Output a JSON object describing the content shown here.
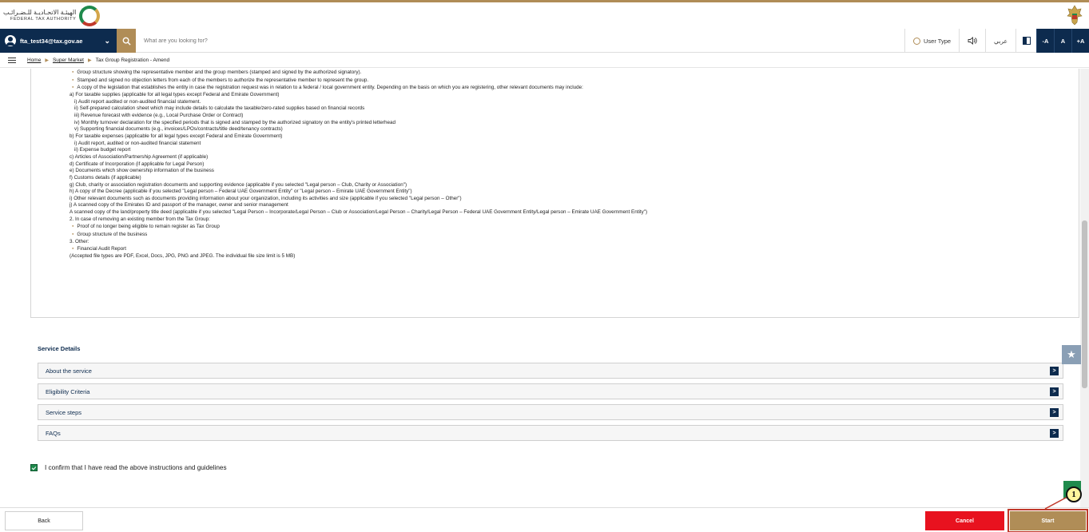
{
  "header": {
    "logo_ar": "الهيئـة الاتحـاديـة للـضـرائـب",
    "logo_en": "FEDERAL TAX AUTHORITY"
  },
  "toolbar": {
    "user_email": "fta_test34@tax.gov.ae",
    "search_placeholder": "What are you looking for?",
    "user_type_label": "User Type",
    "arabic_label": "عربي",
    "font_decrease": "-A",
    "font_normal": "A",
    "font_increase": "+A"
  },
  "breadcrumb": {
    "home": "Home",
    "section": "Super Market",
    "current": "Tax Group Registration - Amend"
  },
  "documents": {
    "lines": [
      {
        "t": "Group structure showing the representative member and the group members (stamped and signed by the authorized signatory).",
        "k": "b"
      },
      {
        "t": "Stamped and signed no objection letters from each of the members to authorize the representative member to represent the group.",
        "k": "b"
      },
      {
        "t": "A copy of the legislation that establishes the entity in case the registration request was in relation to a federal / local government entity. Depending on the basis on which you are registering, other relevant documents may include:",
        "k": "b"
      },
      {
        "t": "a) For taxable supplies (applicable for all legal types except Federal and Emirate Government)",
        "k": ""
      },
      {
        "t": "i) Audit report audited or non-audited financial statement.",
        "k": "i1"
      },
      {
        "t": "ii) Self-prepared calculation sheet which may include details to calculate the taxable/zero-rated supplies based on financial records",
        "k": "i1"
      },
      {
        "t": "iii) Revenue forecast with evidence (e.g., Local Purchase Order or Contract)",
        "k": "i1"
      },
      {
        "t": "iv) Monthly turnover declaration for the specified periods that is signed and stamped by the authorized signatory on the entity's printed letterhead",
        "k": "i1"
      },
      {
        "t": "v) Supporting financial documents (e.g., invoices/LPOs/contracts/title deed/tenancy contracts)",
        "k": "i1"
      },
      {
        "t": "b) For taxable expenses (applicable for all legal types except Federal and Emirate Government)",
        "k": ""
      },
      {
        "t": "i) Audit report, audited or non-audited financial statement",
        "k": "i1"
      },
      {
        "t": "ii) Expense budget report",
        "k": "i1"
      },
      {
        "t": "c) Articles of Association/Partnership Agreement (if applicable)",
        "k": ""
      },
      {
        "t": "d) Certificate of Incorporation (if applicable for Legal Person)",
        "k": ""
      },
      {
        "t": "e) Documents which show ownership information of the business",
        "k": ""
      },
      {
        "t": "f) Customs details (if applicable)",
        "k": ""
      },
      {
        "t": "g) Club, charity or association registration documents and supporting evidence (applicable if you selected \"Legal person – Club, Charity or Association\")",
        "k": ""
      },
      {
        "t": "h) A copy of the Decree (applicable if you selected \"Legal person – Federal UAE Government Entity\" or \"Legal person – Emirate UAE Government Entity\")",
        "k": ""
      },
      {
        "t": "i) Other relevant documents such as documents providing information about your organization, including its activities and size (applicable if you selected \"Legal person – Other\")",
        "k": ""
      },
      {
        "t": "j) A scanned copy of the Emirates ID and passport of the manager, owner and senior management",
        "k": ""
      },
      {
        "t": "A scanned copy of the land/property title deed (applicable if you selected \"Legal Person – Incorporate/Legal Person – Club or Association/Legal Person – Charity/Legal Person – Federal UAE Government Entity/Legal person – Emirate UAE Government Entity\")",
        "k": ""
      },
      {
        "t": "2. In case of removing an existing member from the Tax Group:",
        "k": ""
      },
      {
        "t": "Proof of no longer being eligible to remain register as Tax Group",
        "k": "b"
      },
      {
        "t": "Group structure of the business",
        "k": "b"
      },
      {
        "t": "3. Other:",
        "k": ""
      },
      {
        "t": "Financial Audit Report",
        "k": "b"
      },
      {
        "t": "(Accepted file types are PDF, Excel, Docs, JPG, PNG and JPEG. The individual file size limit is 5 MB)",
        "k": ""
      }
    ]
  },
  "service_details": {
    "title": "Service Details",
    "items": [
      "About the service",
      "Eligibility Criteria",
      "Service steps",
      "FAQs"
    ],
    "expand_glyph": ">"
  },
  "confirm": {
    "label": "I confirm that I have read the above instructions and guidelines",
    "checked": true
  },
  "footer": {
    "back_label": "Back",
    "cancel_label": "Cancel",
    "start_label": "Start"
  },
  "annotation": {
    "step_number": "1"
  },
  "colors": {
    "navy": "#0d2b4e",
    "gold": "#b08d57",
    "cancel_red": "#e8121f",
    "confirm_green": "#1f8a4c"
  }
}
